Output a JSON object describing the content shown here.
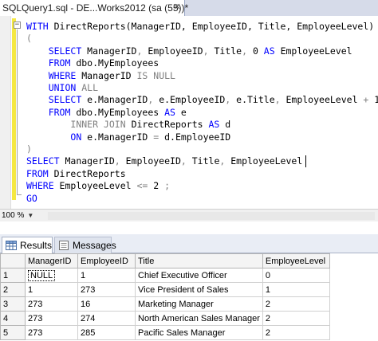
{
  "tab": {
    "title": "SQLQuery1.sql - DE...Works2012 (sa (55))*",
    "close_glyph": "✕"
  },
  "editor": {
    "collapse_glyph": "−",
    "lines": [
      [
        [
          "kw",
          "WITH "
        ],
        [
          "",
          "DirectReports(ManagerID, EmployeeID, Title, EmployeeLevel) "
        ],
        [
          "kw",
          "AS"
        ]
      ],
      [
        [
          "gr",
          "("
        ]
      ],
      [
        [
          "",
          "    "
        ],
        [
          "kw",
          "SELECT "
        ],
        [
          "",
          "ManagerID"
        ],
        [
          "gr",
          ", "
        ],
        [
          "",
          "EmployeeID"
        ],
        [
          "gr",
          ", "
        ],
        [
          "",
          "Title"
        ],
        [
          "gr",
          ", "
        ],
        [
          "",
          "0 "
        ],
        [
          "kw",
          "AS "
        ],
        [
          "",
          "EmployeeLevel"
        ]
      ],
      [
        [
          "",
          "    "
        ],
        [
          "kw",
          "FROM "
        ],
        [
          "",
          "dbo.MyEmployees"
        ]
      ],
      [
        [
          "",
          "    "
        ],
        [
          "kw",
          "WHERE "
        ],
        [
          "",
          "ManagerID "
        ],
        [
          "gr",
          "IS NULL"
        ]
      ],
      [
        [
          "",
          "    "
        ],
        [
          "kw",
          "UNION "
        ],
        [
          "gr",
          "ALL"
        ]
      ],
      [
        [
          "",
          "    "
        ],
        [
          "kw",
          "SELECT "
        ],
        [
          "",
          "e.ManagerID"
        ],
        [
          "gr",
          ", "
        ],
        [
          "",
          "e.EmployeeID"
        ],
        [
          "gr",
          ", "
        ],
        [
          "",
          "e.Title"
        ],
        [
          "gr",
          ", "
        ],
        [
          "",
          "EmployeeLevel "
        ],
        [
          "gr",
          "+ "
        ],
        [
          "",
          "1"
        ]
      ],
      [
        [
          "",
          "    "
        ],
        [
          "kw",
          "FROM "
        ],
        [
          "",
          "dbo.MyEmployees "
        ],
        [
          "kw",
          "AS "
        ],
        [
          "",
          "e"
        ]
      ],
      [
        [
          "",
          "        "
        ],
        [
          "gr",
          "INNER JOIN "
        ],
        [
          "",
          "DirectReports "
        ],
        [
          "kw",
          "AS "
        ],
        [
          "",
          "d"
        ]
      ],
      [
        [
          "",
          "        "
        ],
        [
          "kw",
          "ON "
        ],
        [
          "",
          "e.ManagerID "
        ],
        [
          "gr",
          "= "
        ],
        [
          "",
          "d.EmployeeID"
        ]
      ],
      [
        [
          "gr",
          ")"
        ]
      ],
      [
        [
          "kw",
          "SELECT "
        ],
        [
          "",
          "ManagerID"
        ],
        [
          "gr",
          ", "
        ],
        [
          "",
          "EmployeeID"
        ],
        [
          "gr",
          ", "
        ],
        [
          "",
          "Title"
        ],
        [
          "gr",
          ", "
        ],
        [
          "",
          "EmployeeLevel"
        ]
      ],
      [
        [
          "kw",
          "FROM "
        ],
        [
          "",
          "DirectReports"
        ]
      ],
      [
        [
          "kw",
          "WHERE "
        ],
        [
          "",
          "EmployeeLevel "
        ],
        [
          "gr",
          "<= "
        ],
        [
          "",
          "2 "
        ],
        [
          "gr",
          ";"
        ]
      ],
      [
        [
          "kw",
          "GO"
        ]
      ]
    ]
  },
  "zoom": {
    "label": "100 %",
    "arrow": "▼"
  },
  "results": {
    "tabs": [
      {
        "label": "Results",
        "icon": "grid-icon",
        "active": true
      },
      {
        "label": "Messages",
        "icon": "messages-icon",
        "active": false
      }
    ],
    "columns": [
      "",
      "ManagerID",
      "EmployeeID",
      "Title",
      "EmployeeLevel"
    ],
    "rows": [
      [
        "1",
        "NULL",
        "1",
        "Chief Executive Officer",
        "0"
      ],
      [
        "2",
        "1",
        "273",
        "Vice President of Sales",
        "1"
      ],
      [
        "3",
        "273",
        "16",
        "Marketing Manager",
        "2"
      ],
      [
        "4",
        "273",
        "274",
        "North American Sales Manager",
        "2"
      ],
      [
        "5",
        "273",
        "285",
        "Pacific Sales Manager",
        "2"
      ]
    ]
  },
  "colors": {
    "keyword": "#0000ff",
    "operator": "#808080",
    "change_bar": "#f5e842",
    "tab_strip": "#d6dbe9"
  }
}
